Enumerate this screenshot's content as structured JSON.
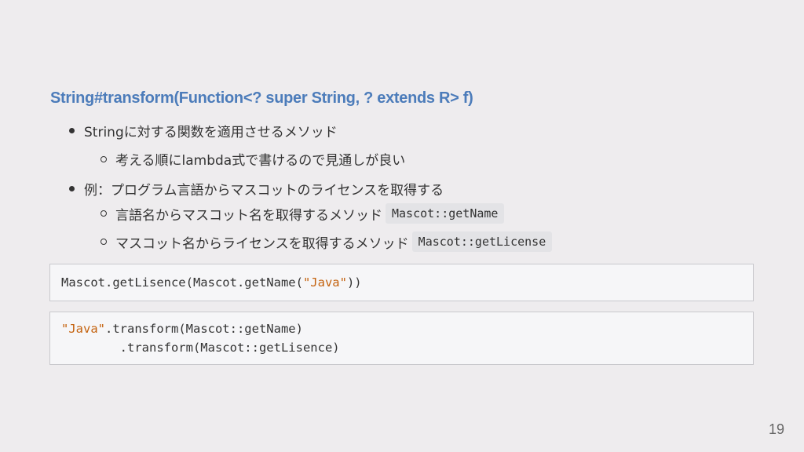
{
  "title": "String#transform(Function<? super String, ? extends R> f)",
  "bullets": [
    {
      "text": "Stringに対する関数を適用させるメソッド",
      "sub": [
        {
          "text": "考える順にlambda式で書けるので見通しが良い"
        }
      ]
    },
    {
      "text": "例：プログラム言語からマスコットのライセンスを取得する",
      "sub": [
        {
          "text": "言語名からマスコット名を取得するメソッド",
          "code": "Mascot::getName"
        },
        {
          "text": "マスコット名からライセンスを取得するメソッド",
          "code": "Mascot::getLicense"
        }
      ]
    }
  ],
  "code_block_1": {
    "line1_before": "Mascot.getLisence(Mascot.getName(",
    "line1_string": "\"Java\"",
    "line1_after": "))"
  },
  "code_block_2": {
    "line1_string": "\"Java\"",
    "line1_after": ".transform(Mascot::getName)",
    "line2": "        .transform(Mascot::getLisence)"
  },
  "page_number": "19",
  "colors": {
    "title": "#4c7cba",
    "string_literal": "#c4620e",
    "background": "#eeecee"
  }
}
